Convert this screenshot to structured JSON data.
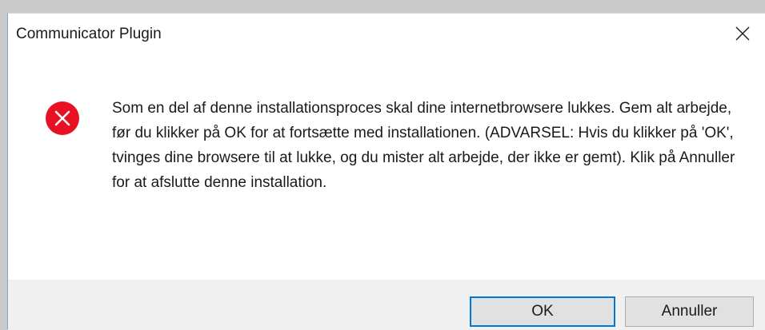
{
  "window": {
    "title": "Communicator Plugin",
    "close_icon": "close-icon"
  },
  "message": {
    "icon": "error-icon",
    "icon_color": "#e81123",
    "text": "Som en del af denne installationsproces skal dine internetbrowsere lukkes. Gem alt arbejde, før du klikker på OK for at fortsætte med installationen. (ADVARSEL: Hvis du klikker på 'OK', tvinges dine browsere til at lukke, og du mister alt arbejde, der ikke er gemt). Klik på Annuller for at afslutte denne installation."
  },
  "buttons": {
    "ok_label": "OK",
    "cancel_label": "Annuller",
    "focus_color": "#0078d7"
  }
}
